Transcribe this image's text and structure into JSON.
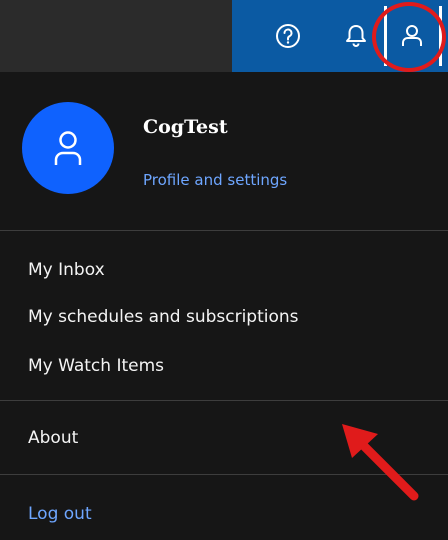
{
  "header": {
    "icons": [
      "help-icon",
      "notification-icon",
      "user-icon"
    ]
  },
  "profile": {
    "name": "CogTest",
    "settings_link": "Profile and settings"
  },
  "menu": {
    "inbox": "My Inbox",
    "schedules": "My schedules and subscriptions",
    "watch_items": "My Watch Items",
    "about": "About",
    "logout": "Log out"
  },
  "colors": {
    "accent": "#0f62fe",
    "link": "#6ea6ff",
    "annotation": "#e01b1b",
    "topbar_blue": "#0b5aa3",
    "panel_bg": "#161616"
  }
}
